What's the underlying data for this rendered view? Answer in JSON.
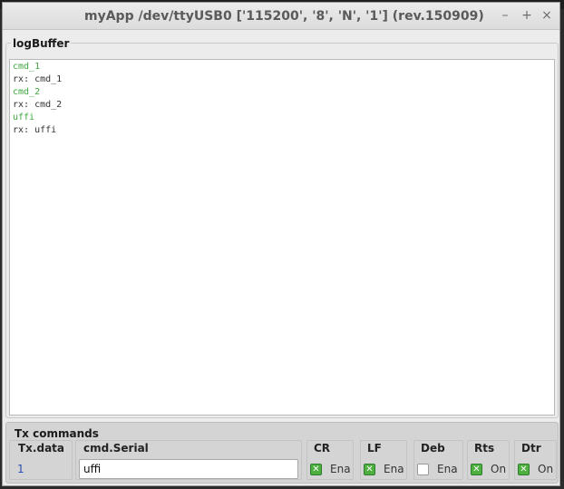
{
  "window": {
    "title": "myApp /dev/ttyUSB0 ['115200', '8', 'N', '1'] (rev.150909)",
    "buttons": {
      "minimize": "–",
      "maximize": "+",
      "close": "×"
    }
  },
  "log": {
    "title": "logBuffer",
    "lines": [
      {
        "text": "cmd_1",
        "kind": "tx"
      },
      {
        "text": "rx: cmd_1",
        "kind": "rx"
      },
      {
        "text": "cmd_2",
        "kind": "tx"
      },
      {
        "text": "rx: cmd_2",
        "kind": "rx"
      },
      {
        "text": "uffi",
        "kind": "tx"
      },
      {
        "text": "rx: uffi",
        "kind": "rx"
      }
    ]
  },
  "tx": {
    "title": "Tx commands",
    "txdata": {
      "label": "Tx.data",
      "value": "1"
    },
    "serial": {
      "label": "cmd.Serial",
      "value": "uffi"
    },
    "checkboxes": [
      {
        "label": "CR",
        "text": "Ena",
        "checked": true
      },
      {
        "label": "LF",
        "text": "Ena",
        "checked": true
      },
      {
        "label": "Deb",
        "text": "Ena",
        "checked": false
      },
      {
        "label": "Rts",
        "text": "On",
        "checked": true
      },
      {
        "label": "Dtr",
        "text": "On",
        "checked": true
      }
    ]
  },
  "colors": {
    "tx_line": "#3fa73f",
    "rx_line": "#333333",
    "checked": "#4caf3e",
    "txdata_value": "#2b4fb3"
  }
}
